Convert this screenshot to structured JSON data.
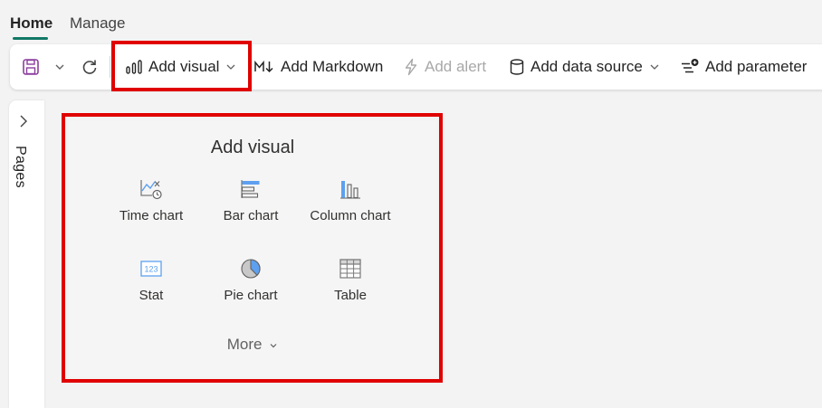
{
  "tabs": {
    "home": "Home",
    "manage": "Manage"
  },
  "toolbar": {
    "add_visual": "Add visual",
    "add_markdown": "Add Markdown",
    "add_alert": "Add alert",
    "add_data_source": "Add data source",
    "add_parameter": "Add parameter"
  },
  "sidebar": {
    "pages_label": "Pages"
  },
  "panel": {
    "title": "Add visual",
    "items": [
      {
        "label": "Time chart",
        "icon": "time-chart-icon"
      },
      {
        "label": "Bar chart",
        "icon": "bar-chart-icon"
      },
      {
        "label": "Column chart",
        "icon": "column-chart-icon"
      },
      {
        "label": "Stat",
        "icon": "stat-icon"
      },
      {
        "label": "Pie chart",
        "icon": "pie-chart-icon"
      },
      {
        "label": "Table",
        "icon": "table-icon"
      }
    ],
    "more": "More",
    "stat_icon_text": "123"
  },
  "colors": {
    "accent": "#117865",
    "highlight": "#e00000",
    "icon_blue": "#5ea0ef",
    "save_purple": "#8b3e9e"
  }
}
